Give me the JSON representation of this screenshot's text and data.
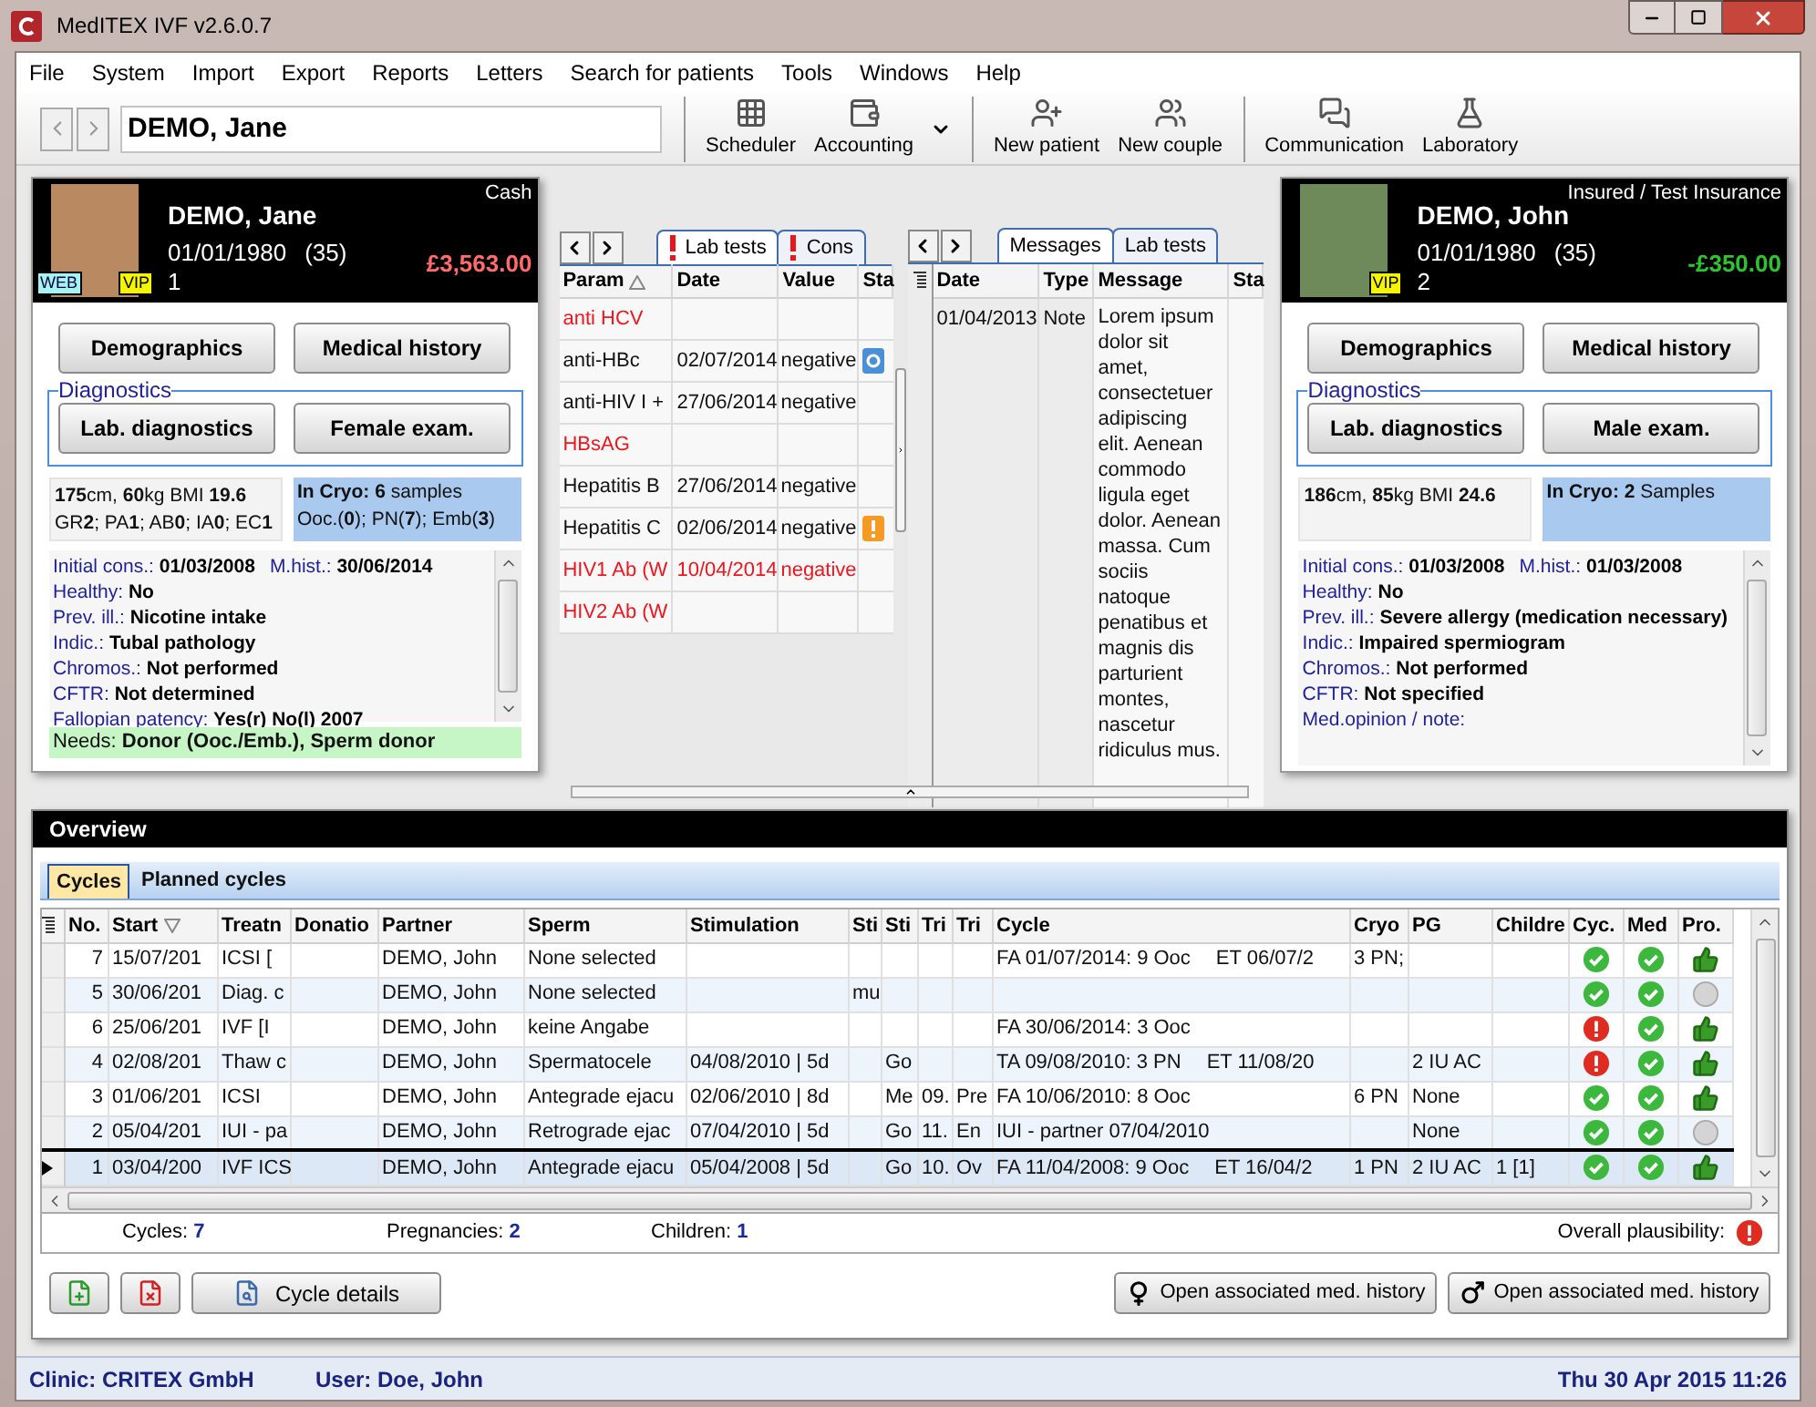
{
  "window": {
    "title": "MedITEX IVF v2.6.0.7"
  },
  "menu": [
    "File",
    "System",
    "Import",
    "Export",
    "Reports",
    "Letters",
    "Search for patients",
    "Tools",
    "Windows",
    "Help"
  ],
  "toolbar": {
    "patient": {
      "value": "DEMO, Jane"
    },
    "buttons": [
      {
        "label": "Scheduler",
        "kind": "scheduler",
        "dropdown": false,
        "separator_before": true
      },
      {
        "label": "Accounting",
        "kind": "accounting",
        "dropdown": true,
        "separator_before": false
      },
      {
        "label": "New patient",
        "kind": "new-patient",
        "dropdown": false,
        "separator_before": true
      },
      {
        "label": "New couple",
        "kind": "new-couple",
        "dropdown": false,
        "separator_before": false
      },
      {
        "label": "Communication",
        "kind": "communication",
        "dropdown": false,
        "separator_before": true
      },
      {
        "label": "Laboratory",
        "kind": "laboratory",
        "dropdown": false,
        "separator_before": false
      }
    ]
  },
  "patients": [
    {
      "payment": "Cash",
      "name": "DEMO, Jane",
      "dob": "01/01/1980",
      "age": "(35)",
      "number": "1",
      "balance": {
        "text": "£3,563.00",
        "color": "#ff6a6a"
      },
      "badges": [
        {
          "label": "WEB",
          "kind": "web"
        },
        {
          "label": "VIP",
          "kind": "vip"
        }
      ],
      "buttons": [
        "Demographics",
        "Medical history"
      ],
      "diagnostics": {
        "label": "Diagnostics",
        "buttons": [
          "Lab. diagnostics",
          "Female exam."
        ]
      },
      "stats": [
        "**175**cm, **60**kg BMI **19.6**",
        "GR**2**; PA**1**; AB**0**; IA**0**; EC**1**"
      ],
      "cryo": [
        "**In Cryo: 6** samples",
        "Ooc.(**0**); PN(**7**); Emb(**3**)"
      ],
      "history": [
        {
          "items": [
            {
              "label": "Initial cons.:",
              "value": "01/03/2008"
            },
            {
              "label": "M.hist.:",
              "value": "30/06/2014"
            }
          ]
        },
        {
          "items": [
            {
              "label": "Healthy:",
              "value": "No"
            }
          ]
        },
        {
          "items": [
            {
              "label": "Prev. ill.:",
              "value": "Nicotine intake"
            }
          ]
        },
        {
          "items": [
            {
              "label": "Indic.:",
              "value": "Tubal pathology"
            }
          ]
        },
        {
          "items": [
            {
              "label": "Chromos.:",
              "value": "Not performed"
            }
          ]
        },
        {
          "items": [
            {
              "label": "CFTR:",
              "value": "Not determined"
            }
          ]
        },
        {
          "items": [
            {
              "label": "Fallopian patency:",
              "value": "Yes(r) No(l) 2007"
            }
          ]
        }
      ],
      "needs": "Needs: **Donor (Ooc./Emb.), Sperm donor**"
    },
    {
      "payment": "Insured / Test Insurance",
      "name": "DEMO, John",
      "dob": "01/01/1980",
      "age": "(35)",
      "number": "2",
      "balance": {
        "text": "-£350.00",
        "color": "#2ec42e"
      },
      "badges": [
        {
          "label": "VIP",
          "kind": "vip"
        }
      ],
      "buttons": [
        "Demographics",
        "Medical history"
      ],
      "diagnostics": {
        "label": "Diagnostics",
        "buttons": [
          "Lab. diagnostics",
          "Male exam."
        ]
      },
      "stats": [
        "**186**cm, **85**kg BMI **24.6**"
      ],
      "cryo": [
        "**In Cryo: 2** Samples"
      ],
      "history": [
        {
          "items": [
            {
              "label": "Initial cons.:",
              "value": "01/03/2008"
            },
            {
              "label": "M.hist.:",
              "value": "01/03/2008"
            }
          ]
        },
        {
          "items": [
            {
              "label": "Healthy:",
              "value": "No"
            }
          ]
        },
        {
          "items": [
            {
              "label": "Prev. ill.:",
              "value": "Severe allergy (medication necessary)"
            }
          ]
        },
        {
          "items": [
            {
              "label": "Indic.:",
              "value": "Impaired spermiogram"
            }
          ]
        },
        {
          "items": [
            {
              "label": "Chromos.:",
              "value": "Not performed"
            }
          ]
        },
        {
          "items": [
            {
              "label": "CFTR:",
              "value": "Not specified"
            }
          ]
        },
        {
          "items": [
            {
              "label": "Med.opinion / note:"
            }
          ]
        }
      ]
    }
  ],
  "lab_panel": {
    "tabs": [
      {
        "label": "Lab tests",
        "selected": true,
        "alert": true
      },
      {
        "label": "Cons",
        "selected": false,
        "alert": true
      }
    ],
    "columns": [
      {
        "label": "Param",
        "marker": {
          "kind": "sort"
        }
      },
      {
        "label": "Date"
      },
      {
        "label": "Value"
      },
      {
        "label": "Sta"
      }
    ],
    "rows": [
      {
        "param": "anti HCV",
        "alert": true
      },
      {
        "param": "anti-HBc",
        "date": "02/07/2014",
        "value": "negative",
        "status": {
          "kind": "ok"
        },
        "alert": false
      },
      {
        "param": "anti-HIV I +",
        "date": "27/06/2014",
        "value": "negative",
        "alert": false
      },
      {
        "param": "HBsAG",
        "alert": true
      },
      {
        "param": "Hepatitis B",
        "date": "27/06/2014",
        "value": "negative",
        "alert": false
      },
      {
        "param": "Hepatitis C",
        "date": "02/06/2014",
        "value": "negative",
        "status": {
          "kind": "warning"
        },
        "alert": false
      },
      {
        "param": "HIV1 Ab (W",
        "date": "10/04/2014",
        "value": "negative",
        "alert": true
      },
      {
        "param": "HIV2 Ab (W",
        "alert": true
      }
    ]
  },
  "messages_panel": {
    "tabs": [
      {
        "label": "Messages",
        "selected": true,
        "alert": false
      },
      {
        "label": "Lab tests",
        "selected": false,
        "alert": false
      }
    ],
    "columns": [
      {
        "label": "Date"
      },
      {
        "label": "Type"
      },
      {
        "label": "Message"
      },
      {
        "label": "Sta"
      }
    ],
    "rows": [
      {
        "date": "01/04/2013",
        "type": "Note",
        "message": "Lorem ipsum dolor sit amet, consectetuer adipiscing elit. Aenean commodo ligula eget dolor. Aenean massa. Cum sociis natoque penatibus et magnis dis parturient montes, nascetur ridiculus mus."
      }
    ]
  },
  "overview": {
    "title": "Overview",
    "tabs": [
      {
        "label": "Cycles",
        "selected": true
      },
      {
        "label": "Planned cycles",
        "selected": false
      }
    ],
    "columns": [
      {
        "label": "No."
      },
      {
        "label": "Start",
        "marker": {
          "kind": "filter"
        }
      },
      {
        "label": "Treatn"
      },
      {
        "label": "Donatio"
      },
      {
        "label": "Partner"
      },
      {
        "label": "Sperm"
      },
      {
        "label": "Stimulation"
      },
      {
        "label": "Sti"
      },
      {
        "label": "Sti"
      },
      {
        "label": "Tri"
      },
      {
        "label": "Tri"
      },
      {
        "label": "Cycle"
      },
      {
        "label": "Cryo"
      },
      {
        "label": "PG"
      },
      {
        "label": "Childre"
      },
      {
        "label": "Cyc."
      },
      {
        "label": "Med"
      },
      {
        "label": "Pro."
      }
    ],
    "rows": [
      {
        "no": "7",
        "start": "15/07/201",
        "treatment": "ICSI [",
        "partner": "DEMO, John",
        "sperm": "None selected",
        "cycle": "FA 01/07/2014: 9 Ooc",
        "et": "ET 06/07/2",
        "cryo": "3 PN;",
        "cyc": {
          "kind": "ok"
        },
        "med": {
          "kind": "ok"
        },
        "pro": {
          "kind": "approved"
        },
        "selected": false
      },
      {
        "no": "5",
        "start": "30/06/201",
        "treatment": "Diag. c",
        "partner": "DEMO, John",
        "sperm": "None selected",
        "sti_1": "mu",
        "cyc": {
          "kind": "ok"
        },
        "med": {
          "kind": "ok"
        },
        "pro": {
          "kind": "neutral"
        },
        "selected": false
      },
      {
        "no": "6",
        "start": "25/06/201",
        "treatment": "IVF [I",
        "partner": "DEMO, John",
        "sperm": "keine Angabe",
        "cycle": "FA 30/06/2014: 3 Ooc",
        "cyc": {
          "kind": "error"
        },
        "med": {
          "kind": "ok"
        },
        "pro": {
          "kind": "approved"
        },
        "selected": false
      },
      {
        "no": "4",
        "start": "02/08/201",
        "treatment": "Thaw c",
        "partner": "DEMO, John",
        "sperm": "Spermatocele",
        "stimulation": "04/08/2010 | 5d",
        "sti_2": "Go",
        "cycle": "TA 09/08/2010: 3 PN",
        "et": "ET 11/08/20",
        "pg": "2 IU AC",
        "cyc": {
          "kind": "error"
        },
        "med": {
          "kind": "ok"
        },
        "pro": {
          "kind": "approved"
        },
        "selected": false
      },
      {
        "no": "3",
        "start": "01/06/201",
        "treatment": "ICSI",
        "partner": "DEMO, John",
        "sperm": "Antegrade ejacu",
        "stimulation": "02/06/2010 | 8d",
        "sti_2": "Me",
        "tri_1": "09.",
        "tri_2": "Pre",
        "cycle": "FA 10/06/2010: 8 Ooc",
        "cryo": "6 PN",
        "pg": "None",
        "cyc": {
          "kind": "ok"
        },
        "med": {
          "kind": "ok"
        },
        "pro": {
          "kind": "approved"
        },
        "selected": false
      },
      {
        "no": "2",
        "start": "05/04/201",
        "treatment": "IUI - pa",
        "partner": "DEMO, John",
        "sperm": "Retrograde ejac",
        "stimulation": "07/04/2010 | 5d",
        "sti_2": "Go",
        "tri_1": "11.",
        "tri_2": "En",
        "cycle": "IUI - partner 07/04/2010",
        "pg": "None",
        "cyc": {
          "kind": "ok"
        },
        "med": {
          "kind": "ok"
        },
        "pro": {
          "kind": "neutral"
        },
        "selected": false
      },
      {
        "no": "1",
        "start": "03/04/200",
        "treatment": "IVF ICS",
        "partner": "DEMO, John",
        "sperm": "Antegrade ejacu",
        "stimulation": "05/04/2008 | 5d",
        "sti_2": "Go",
        "tri_1": "10.",
        "tri_2": "Ov",
        "cycle": "FA 11/04/2008: 9 Ooc",
        "et": "ET 16/04/2",
        "cryo": "1 PN",
        "pg": "2 IU AC",
        "children": "1 [1]",
        "cyc": {
          "kind": "ok"
        },
        "med": {
          "kind": "ok"
        },
        "pro": {
          "kind": "approved"
        },
        "selected": true
      }
    ],
    "summary": [
      {
        "label": "Cycles:",
        "value": "7"
      },
      {
        "label": "Pregnancies:",
        "value": "2"
      },
      {
        "label": "Children:",
        "value": "1"
      }
    ],
    "plausibility": {
      "label": "Overall plausibility:",
      "status": {
        "kind": "error"
      }
    },
    "buttons": [
      {
        "kind": "add"
      },
      {
        "kind": "delete"
      },
      {
        "kind": "details",
        "label": "Cycle details"
      },
      {
        "kind": "female-history",
        "label": "Open associated med. history"
      },
      {
        "kind": "male-history",
        "label": "Open associated med. history"
      }
    ]
  },
  "status_bar": {
    "clinic": "Clinic: CRITEX GmbH",
    "user": "User: Doe, John",
    "datetime": "Thu 30 Apr 2015 11:26"
  }
}
